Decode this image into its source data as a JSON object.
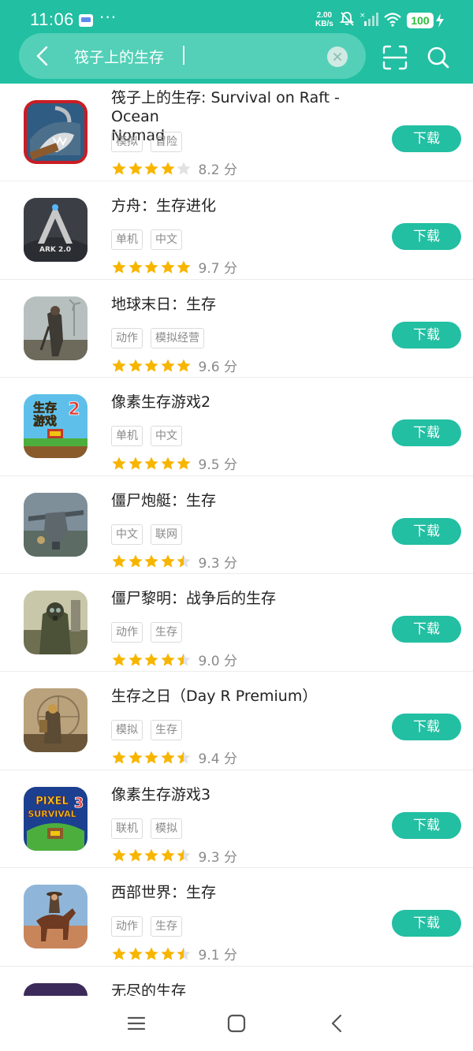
{
  "status_bar": {
    "time": "11:06",
    "dots": "···",
    "net_speed_value": "2.00",
    "net_speed_unit": "KB/s",
    "battery": "100"
  },
  "search": {
    "query": "筏子上的生存"
  },
  "apps": [
    {
      "title_line1": "筏子上的生存: Survival on Raft - Ocean",
      "title_line2": "Nomad",
      "tags": [
        "模拟",
        "冒险"
      ],
      "rating": 4,
      "score": "8.2 分",
      "download": "下载",
      "icon": "raft-shark-icon"
    },
    {
      "title_line1": "方舟：生存进化",
      "title_line2": "",
      "tags": [
        "单机",
        "中文"
      ],
      "rating": 5,
      "score": "9.7 分",
      "download": "下载",
      "icon": "ark-icon"
    },
    {
      "title_line1": "地球末日：生存",
      "title_line2": "",
      "tags": [
        "动作",
        "模拟经营"
      ],
      "rating": 5,
      "score": "9.6 分",
      "download": "下载",
      "icon": "survivor-icon"
    },
    {
      "title_line1": "像素生存游戏2",
      "title_line2": "",
      "tags": [
        "单机",
        "中文"
      ],
      "rating": 5,
      "score": "9.5 分",
      "download": "下载",
      "icon": "pixel-survival-2-icon"
    },
    {
      "title_line1": "僵尸炮艇：生存",
      "title_line2": "",
      "tags": [
        "中文",
        "联网"
      ],
      "rating": 4.5,
      "score": "9.3 分",
      "download": "下载",
      "icon": "gunship-icon"
    },
    {
      "title_line1": "僵尸黎明：战争后的生存",
      "title_line2": "",
      "tags": [
        "动作",
        "生存"
      ],
      "rating": 4.5,
      "score": "9.0 分",
      "download": "下载",
      "icon": "gasmask-soldier-icon"
    },
    {
      "title_line1": "生存之日（Day R Premium）",
      "title_line2": "",
      "tags": [
        "模拟",
        "生存"
      ],
      "rating": 4.5,
      "score": "9.4 分",
      "download": "下载",
      "icon": "day-r-icon"
    },
    {
      "title_line1": "像素生存游戏3",
      "title_line2": "",
      "tags": [
        "联机",
        "模拟"
      ],
      "rating": 4.5,
      "score": "9.3 分",
      "download": "下载",
      "icon": "pixel-survival-3-icon"
    },
    {
      "title_line1": "西部世界：生存",
      "title_line2": "",
      "tags": [
        "动作",
        "生存"
      ],
      "rating": 4.5,
      "score": "9.1 分",
      "download": "下载",
      "icon": "cowboy-horse-icon"
    },
    {
      "title_line1": "无尽的生存",
      "title_line2": "",
      "tags": [],
      "rating": 0,
      "score": "",
      "download": "",
      "icon": "endless-survival-icon"
    }
  ],
  "icon_text": {
    "ark_logo": "ARK 2.0",
    "pixel2_line1": "生存",
    "pixel2_line2": "游戏",
    "pixel2_num": "2",
    "pixel3_line1": "PIXEL",
    "pixel3_line2": "SURVIVAL",
    "pixel3_num": "3"
  },
  "colors": {
    "brand": "#22bfa2",
    "star": "#f7b500",
    "star_empty": "#e2e2e2"
  }
}
